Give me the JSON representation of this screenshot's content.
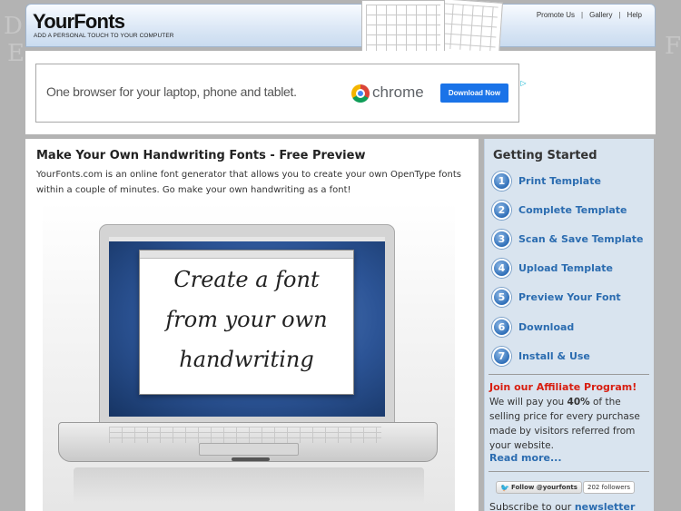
{
  "header": {
    "logo": "YourFonts",
    "tagline": "ADD A PERSONAL TOUCH TO YOUR COMPUTER",
    "links": [
      "Promote Us",
      "Gallery",
      "Help"
    ],
    "separator": "|"
  },
  "ad": {
    "text": "One browser for your laptop, phone and tablet.",
    "brand": "chrome",
    "button": "Download Now"
  },
  "main": {
    "title": "Make Your Own Handwriting Fonts - Free Preview",
    "intro": "YourFonts.com is an online font generator that allows you to create your own OpenType fonts within a couple of minutes. Go make your own handwriting as a font!",
    "screen_lines": [
      "Create a font",
      "from your own",
      "handwriting"
    ]
  },
  "sidebar": {
    "title": "Getting Started",
    "steps": [
      {
        "num": "1",
        "label": "Print Template"
      },
      {
        "num": "2",
        "label": "Complete Template"
      },
      {
        "num": "3",
        "label": "Scan & Save Template"
      },
      {
        "num": "4",
        "label": "Upload Template"
      },
      {
        "num": "5",
        "label": "Preview Your Font"
      },
      {
        "num": "6",
        "label": "Download"
      },
      {
        "num": "7",
        "label": "Install & Use"
      }
    ],
    "affiliate": {
      "title": "Join our Affiliate Program!",
      "text_before": "We will pay you ",
      "percent": "40%",
      "text_after": " of the selling price for every purchase made by visitors referred from your website.",
      "read_more": "Read more..."
    },
    "twitter": {
      "button": "Follow @yourfonts",
      "followers": "202 followers"
    },
    "subscribe": {
      "text": "Subscribe to our ",
      "link": "newsletter"
    }
  }
}
